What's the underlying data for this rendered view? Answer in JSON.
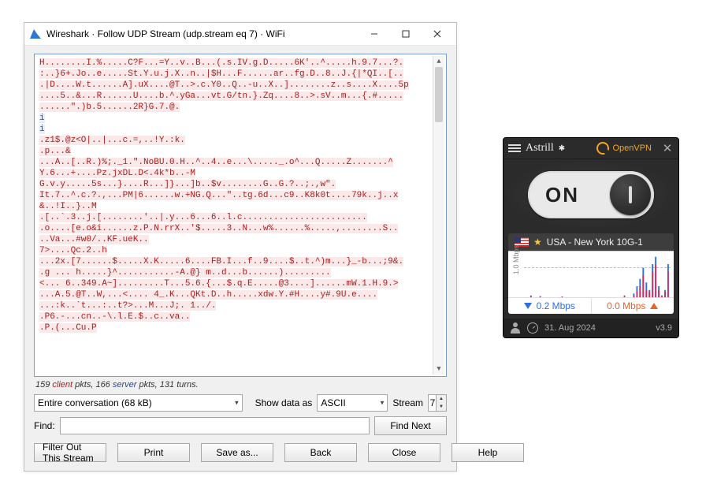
{
  "wireshark": {
    "title": "Wireshark · Follow UDP Stream (udp.stream eq 7) · WiFi",
    "stream_lines": [
      {
        "c": "cl",
        "t": "H........I.%.....C?F...=Y..v..B...(.s.IV.g.D.....6K'..^.....h.9.7...?."
      },
      {
        "c": "cl",
        "t": ":..}6+.Jo..e.....St.Y.u.j.X..n..|$H...F......ar..fg.D..8..J.{|*QI..[.."
      },
      {
        "c": "cl",
        "t": ".|D....W.t......A].uX....@T..>.c.Y0..Q..-u..X..]........z..s....X....5p"
      },
      {
        "c": "cl",
        "t": "....5..&...R......U....b.^.yGa...vt.G/tn.}.Zq....8..>.sV..m...{.#....."
      },
      {
        "c": "cl",
        "t": "......\".)b.5......2R}G.7.@."
      },
      {
        "c": "sv",
        "t": "i"
      },
      {
        "c": "sv",
        "t": "i"
      },
      {
        "c": "cl",
        "t": ".z1$.@z<O|..|...c.=,..!Y.:k."
      },
      {
        "c": "cl",
        "t": ".p...&"
      },
      {
        "c": "cl",
        "t": "...A..[..R.)%;._1.\".NoBU.0.H..^..4..e...\\....._.o^...Q.....Z.......^"
      },
      {
        "c": "cl",
        "t": "Y.6...+....Pz.jxDL.D<.4k*b..-M"
      },
      {
        "c": "cl",
        "t": "G.v.y.....5s...}....R...]}...]b..$v........G..G.?..;.,w\"."
      },
      {
        "c": "cl",
        "t": "It.7..^.c.?.,...PM|6......w.+NG.Q...\"..tg.6d...c9..K8k0t....79k..j..x"
      },
      {
        "c": "cl",
        "t": "&..!I..}..M"
      },
      {
        "c": "cl",
        "t": ".[..`.3..j.[........'..|.y...6...6..l.c........................"
      },
      {
        "c": "cl",
        "t": ".o....[e.o&i......z.P.N.rrX..'$.....3..N...w%......%.....,........S.."
      },
      {
        "c": "cl",
        "t": "..Va...#w0/..KF.ueK.."
      },
      {
        "c": "cl",
        "t": "7>....Qc.2..h"
      },
      {
        "c": "cl",
        "t": "...2x.[7......$.....X.K.....6....FB.I...f..9....$..t.^)m...}_-b...;9&."
      },
      {
        "c": "cl",
        "t": ".g        ...  h.....}^...........-A.@}      m..d...b......)........."
      },
      {
        "c": "cl",
        "t": "<... 6..349.A~].........T...5.6.{...$.q.E.....@3....]......mW.1.H.9.>"
      },
      {
        "c": "cl",
        "t": "...A.5.@T..W,...<.... 4_.K...QKt.D..h.....xdw.Y.#H....y#.9U.e...."
      },
      {
        "c": "cl",
        "t": "...:k..`t...:..t?>...M...J;.       1../."
      },
      {
        "c": "cl",
        "t": ".P6.-...cn..-\\.l.E.$..c..va.."
      },
      {
        "c": "cl",
        "t": ".P.(...Cu.P"
      }
    ],
    "summary": {
      "prefix": "159 ",
      "client_word": "client",
      "mid1": " pkts, 166 ",
      "server_word": "server",
      "suffix": " pkts, 131 turns."
    },
    "conversation_combo": "Entire conversation (68 kB)",
    "show_as_label": "Show data as",
    "showas_combo": "ASCII",
    "stream_label": "Stream",
    "stream_value": "7",
    "find_label": "Find:",
    "find_next": "Find Next",
    "buttons": {
      "filter_out": "Filter Out This Stream",
      "print": "Print",
      "save_as": "Save as...",
      "back": "Back",
      "close": "Close",
      "help": "Help"
    }
  },
  "astrill": {
    "brand": "Astrill",
    "protocol": "OpenVPN",
    "toggle_text": "ON",
    "server": "USA - New York 10G-1",
    "graph_ylabel": "1.0 Mbps",
    "down_speed": "0.2 Mbps",
    "up_speed": "0.0 Mbps",
    "date": "31. Aug 2024",
    "version": "v3.9"
  },
  "chart_data": {
    "type": "line",
    "title": "",
    "xlabel": "",
    "ylabel": "1.0 Mbps",
    "ylim": [
      0,
      1.2
    ],
    "series": [
      {
        "name": "download",
        "color": "#2e6fe0",
        "values": [
          0,
          0,
          0.05,
          0,
          0,
          0.03,
          0,
          0,
          0,
          0,
          0,
          0,
          0.02,
          0,
          0,
          0,
          0,
          0,
          0,
          0,
          0,
          0,
          0,
          0,
          0,
          0,
          0,
          0,
          0,
          0,
          0,
          0,
          0.05,
          0,
          0,
          0.1,
          0.3,
          0.5,
          0.8,
          0.4,
          0.2,
          0.9,
          1.1,
          0.3,
          0.05,
          0.2,
          0.9,
          0.1
        ]
      },
      {
        "name": "upload",
        "color": "#c6316b",
        "values": [
          0,
          0,
          0.02,
          0,
          0,
          0.02,
          0,
          0,
          0,
          0,
          0,
          0,
          0.02,
          0,
          0,
          0,
          0,
          0,
          0,
          0,
          0,
          0,
          0,
          0,
          0,
          0,
          0,
          0,
          0,
          0,
          0,
          0,
          0.03,
          0,
          0,
          0.05,
          0.15,
          0.3,
          0.6,
          0.2,
          0.15,
          0.7,
          0.9,
          0.2,
          0.03,
          0.15,
          0.7,
          0.05
        ]
      }
    ]
  }
}
